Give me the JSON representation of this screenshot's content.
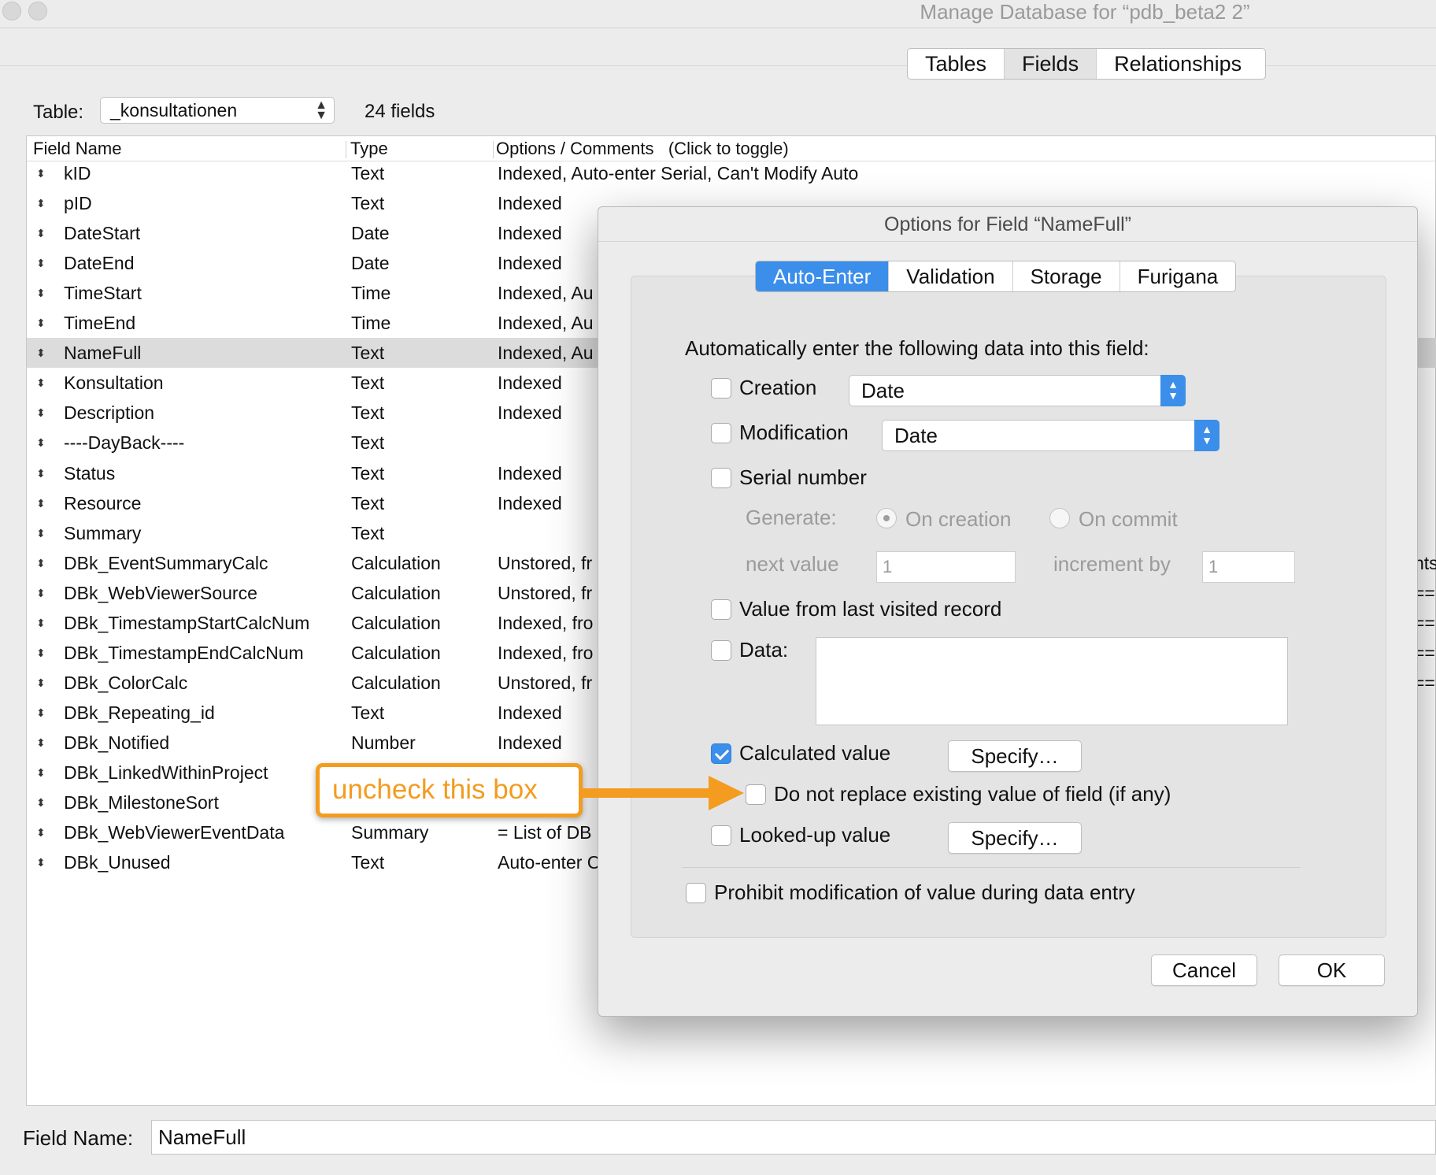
{
  "window": {
    "title": "Manage Database for “pdb_beta2 2”"
  },
  "main_tabs": [
    "Tables",
    "Fields",
    "Relationships"
  ],
  "table_selector": {
    "label": "Table:",
    "value": "_konsultationen",
    "field_count": "24 fields"
  },
  "columns": {
    "name": "Field Name",
    "type": "Type",
    "options": "Options / Comments   (Click to toggle)"
  },
  "fields": [
    {
      "name": "kID",
      "type": "Text",
      "options": "Indexed, Auto-enter Serial, Can't Modify Auto"
    },
    {
      "name": "pID",
      "type": "Text",
      "options": "Indexed"
    },
    {
      "name": "DateStart",
      "type": "Date",
      "options": "Indexed"
    },
    {
      "name": "DateEnd",
      "type": "Date",
      "options": "Indexed"
    },
    {
      "name": "TimeStart",
      "type": "Time",
      "options": "Indexed, Au"
    },
    {
      "name": "TimeEnd",
      "type": "Time",
      "options": "Indexed, Au"
    },
    {
      "name": "NameFull",
      "type": "Text",
      "options": "Indexed, Au"
    },
    {
      "name": "Konsultation",
      "type": "Text",
      "options": "Indexed"
    },
    {
      "name": "Description",
      "type": "Text",
      "options": "Indexed"
    },
    {
      "name": "----DayBack----",
      "type": "Text",
      "options": ""
    },
    {
      "name": "Status",
      "type": "Text",
      "options": "Indexed"
    },
    {
      "name": "Resource",
      "type": "Text",
      "options": "Indexed"
    },
    {
      "name": "Summary",
      "type": "Text",
      "options": ""
    },
    {
      "name": "DBk_EventSummaryCalc",
      "type": "Calculation",
      "options": "Unstored, fr"
    },
    {
      "name": "DBk_WebViewerSource",
      "type": "Calculation",
      "options": "Unstored, fr"
    },
    {
      "name": "DBk_TimestampStartCalcNum",
      "type": "Calculation",
      "options": "Indexed, fro"
    },
    {
      "name": "DBk_TimestampEndCalcNum",
      "type": "Calculation",
      "options": "Indexed, fro"
    },
    {
      "name": "DBk_ColorCalc",
      "type": "Calculation",
      "options": "Unstored, fr"
    },
    {
      "name": "DBk_Repeating_id",
      "type": "Text",
      "options": "Indexed"
    },
    {
      "name": "DBk_Notified",
      "type": "Number",
      "options": "Indexed"
    },
    {
      "name": "DBk_LinkedWithinProject",
      "type": "",
      "options": ""
    },
    {
      "name": "DBk_MilestoneSort",
      "type": "",
      "options": ""
    },
    {
      "name": "DBk_WebViewerEventData",
      "type": "Summary",
      "options": "= List of DB"
    },
    {
      "name": "DBk_Unused",
      "type": "Text",
      "options": "Auto-enter C"
    }
  ],
  "right_edge_fragments": [
    "nts",
    "==",
    "==",
    "==",
    "=="
  ],
  "selected_field": "NameFull",
  "field_name": {
    "label": "Field Name:",
    "value": "NameFull"
  },
  "dialog": {
    "title": "Options for Field “NameFull”",
    "tabs": [
      "Auto-Enter",
      "Validation",
      "Storage",
      "Furigana"
    ],
    "active_tab": "Auto-Enter",
    "heading": "Automatically enter the following data into this field:",
    "creation": {
      "label": "Creation",
      "checked": false,
      "value": "Date"
    },
    "modification": {
      "label": "Modification",
      "checked": false,
      "value": "Date"
    },
    "serial": {
      "label": "Serial number",
      "checked": false,
      "generate_label": "Generate:",
      "on_creation": "On creation",
      "on_commit": "On commit",
      "next_value_label": "next value",
      "next_value": "1",
      "increment_label": "increment by",
      "increment": "1"
    },
    "last_visited": {
      "label": "Value from last visited record",
      "checked": false
    },
    "data": {
      "label": "Data:",
      "checked": false,
      "value": ""
    },
    "calculated": {
      "label": "Calculated value",
      "checked": true,
      "button": "Specify…"
    },
    "do_not_replace": {
      "label": "Do not replace existing value of field (if any)",
      "checked": false
    },
    "looked_up": {
      "label": "Looked-up value",
      "checked": false,
      "button": "Specify…"
    },
    "prohibit": {
      "label": "Prohibit modification of value during data entry",
      "checked": false
    },
    "cancel": "Cancel",
    "ok": "OK"
  },
  "annotation": {
    "text": "uncheck this box",
    "color": "#f39c1f"
  },
  "colors": {
    "accent": "#3b8ee9",
    "selected_row": "#dcdcdc",
    "annotation": "#f39c1f"
  }
}
